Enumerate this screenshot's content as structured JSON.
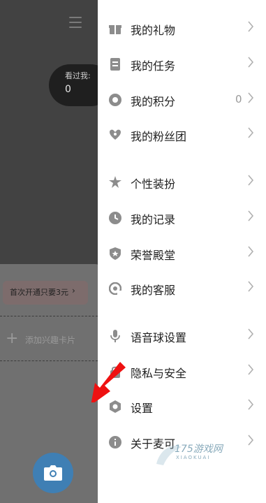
{
  "left_panel": {
    "seen_label": "看过我:",
    "seen_value": "0",
    "promo_text": "首次开通只要3元",
    "promo_chevron": "›",
    "add_card_label": "添加兴趣卡片"
  },
  "drawer": {
    "items": [
      {
        "label": "我的礼物",
        "icon": "gift-icon"
      },
      {
        "label": "我的任务",
        "icon": "task-icon"
      },
      {
        "label": "我的积分",
        "icon": "points-icon",
        "value": "0"
      },
      {
        "label": "我的粉丝团",
        "icon": "fan-club-icon"
      },
      {
        "label": "个性装扮",
        "icon": "dressup-icon"
      },
      {
        "label": "我的记录",
        "icon": "clock-icon"
      },
      {
        "label": "荣誉殿堂",
        "icon": "shield-icon"
      },
      {
        "label": "我的客服",
        "icon": "customer-service-icon"
      },
      {
        "label": "语音球设置",
        "icon": "microphone-icon"
      },
      {
        "label": "隐私与安全",
        "icon": "lock-icon"
      },
      {
        "label": "设置",
        "icon": "gear-icon"
      },
      {
        "label": "关于麦可",
        "icon": "info-icon"
      }
    ]
  },
  "watermark": {
    "text": "175游戏网",
    "sub": "XIAOKUAI"
  },
  "colors": {
    "icon_gray": "#8c8c8c",
    "chevron_gray": "#b0b0b0",
    "arrow_red": "#ee1111",
    "camera_blue": "#3f7fb4"
  }
}
